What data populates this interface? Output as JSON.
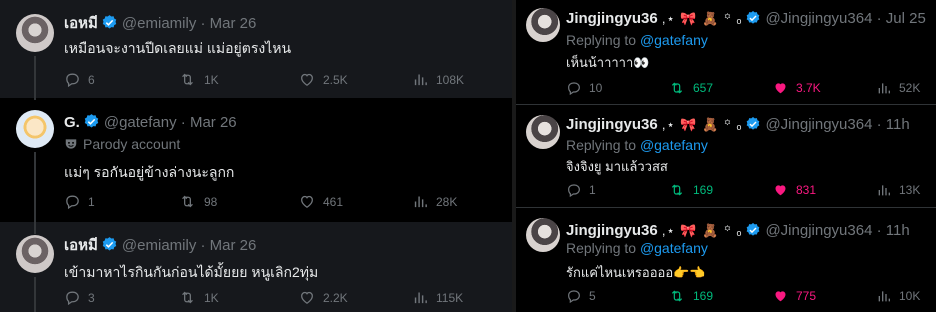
{
  "left_thread": [
    {
      "name": "เอหมี",
      "handle": "@emiamily",
      "dot": "·",
      "date": "Mar 26",
      "text": "เหมือนจะงานปีดเลยแม่ แม่อยู่ตรงไหน",
      "replies": "6",
      "retweets": "1K",
      "likes": "2.5K",
      "views": "108K"
    },
    {
      "name": "G.",
      "handle": "@gatefany",
      "dot": "·",
      "date": "Mar 26",
      "label": "Parody account",
      "text": "แม่ๆ รอกันอยู่ข้างล่างนะลูกก",
      "replies": "1",
      "retweets": "98",
      "likes": "461",
      "views": "28K"
    },
    {
      "name": "เอหมี",
      "handle": "@emiamily",
      "dot": "·",
      "date": "Mar 26",
      "text": "เข้ามาหาไรกินกันก่อนได้มั้ยยย หนูเลิก2ทุ่ม",
      "replies": "3",
      "retweets": "1K",
      "likes": "2.2K",
      "views": "115K"
    }
  ],
  "right_thread": [
    {
      "name": "Jingjingyu36",
      "handle": "@Jingjingyu364",
      "dot": "·",
      "date": "Jul 25",
      "replying_prefix": "Replying to",
      "replying_to": "@gatefany",
      "text": "เห็นน้าาาาา👀",
      "replies": "10",
      "retweets": "657",
      "likes": "3.7K",
      "views": "52K"
    },
    {
      "name": "Jingjingyu36",
      "handle": "@Jingjingyu364",
      "dot": "·",
      "date": "11h",
      "replying_prefix": "Replying to",
      "replying_to": "@gatefany",
      "text": "จิงจิงยู มาแล้ววสส",
      "replies": "1",
      "retweets": "169",
      "likes": "831",
      "views": "13K"
    },
    {
      "name": "Jingjingyu36",
      "handle": "@Jingjingyu364",
      "dot": "·",
      "date": "11h",
      "replying_prefix": "Replying to",
      "replying_to": "@gatefany",
      "text": "รักแค่ไหนเหรออออ👉👈",
      "replies": "5",
      "retweets": "169",
      "likes": "775",
      "views": "10K"
    }
  ],
  "name_decoration": ",⋆ 🎀 🧸 ꙳ ₒ",
  "colors": {
    "background": "#000000",
    "text": "#e7e9ea",
    "muted": "#71767b",
    "link": "#1d9bf0",
    "verified": "#1d9bf0",
    "retweet_active": "#00ba7c",
    "like_active": "#f91880"
  },
  "icons": [
    "verified-badge-icon",
    "reply-icon",
    "retweet-icon",
    "like-icon",
    "views-icon",
    "parody-mask-icon"
  ]
}
